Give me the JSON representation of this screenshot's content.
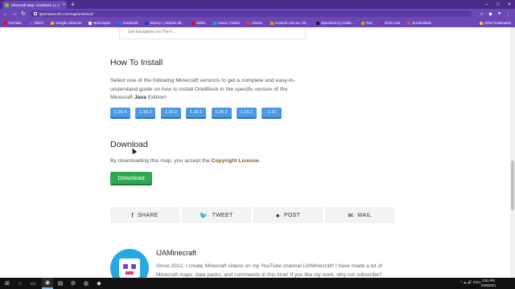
{
  "browser": {
    "tab_title": "Minecraft Map: OneBlock (1.16.4...",
    "tab_close": "×",
    "new_tab": "+",
    "url": "ijamminecraft.com/map/oneblock/",
    "win": {
      "min": "–",
      "max": "□",
      "close": "×"
    },
    "nav": {
      "back": "←",
      "forward": "→",
      "reload": "↻"
    },
    "tools": {
      "star": "☆",
      "ext": "◆",
      "profile": "●",
      "menu": "⋮"
    }
  },
  "bookmarks": [
    {
      "label": "YouTube",
      "color": "#ff0000"
    },
    {
      "label": "Twitch",
      "color": "#9146ff"
    },
    {
      "label": "Google AdSense",
      "color": "#fbbc05"
    },
    {
      "label": "Best Super",
      "color": "#ffffff"
    },
    {
      "label": "Facebook",
      "color": "#1877f2"
    },
    {
      "label": "Disney+ | Stream all...",
      "color": "#113ccf"
    },
    {
      "label": "Netflix",
      "color": "#e50914"
    },
    {
      "label": "Home / Twitter",
      "color": "#1da1f2"
    },
    {
      "label": "GMAIL",
      "color": "#ea4335"
    },
    {
      "label": "Amazon.com.au: Sh...",
      "color": "#ff9900"
    },
    {
      "label": "Speedtest by Ookla...",
      "color": "#141526"
    },
    {
      "label": "PLE",
      "color": "#e5a00d"
    },
    {
      "label": "GOG.com",
      "color": "#86328a"
    },
    {
      "label": "Social Blade",
      "color": "#d9534f"
    }
  ],
  "other_bookmarks": "Other bookmarks",
  "prev_card_text": "Get Exceptions Int The F...",
  "install": {
    "heading": "How To Install",
    "text_before": "Select one of the following Minecraft versions to get a complete and easy-to-understand guide on how to install OneBlock in the specific version of the Minecraft ",
    "text_bold": "Java",
    "text_after": " Edition!",
    "versions": [
      "1.16.4",
      "1.16.3",
      "1.16.2",
      "1.16.1",
      "1.15.2",
      "1.15.1",
      "1.15"
    ]
  },
  "download": {
    "heading": "Download",
    "note": "By downloading this map, you accept the ",
    "license_link": "Copyright License",
    "note_end": ".",
    "button": "Download"
  },
  "share": [
    {
      "icon": "f",
      "icon_name": "facebook-icon",
      "label": "SHARE"
    },
    {
      "icon": "🐦",
      "icon_name": "twitter-icon",
      "label": "TWEET"
    },
    {
      "icon": "●",
      "icon_name": "reddit-icon",
      "label": "POST"
    },
    {
      "icon": "✉",
      "icon_name": "mail-icon",
      "label": "MAIL"
    }
  ],
  "author": {
    "name": "IJAMinecraft",
    "bio": "Since 2012, I create Minecraft videos on my YouTube channel IJAMinecraft! I have made a lot of Minecraft maps, data packs, and commands in this time! If you like my work, why not subscribe?"
  },
  "taskbar": {
    "time": "2:51 PM",
    "date": "2/28/2021",
    "tray": "^ ☁ 🔊 ENG"
  }
}
